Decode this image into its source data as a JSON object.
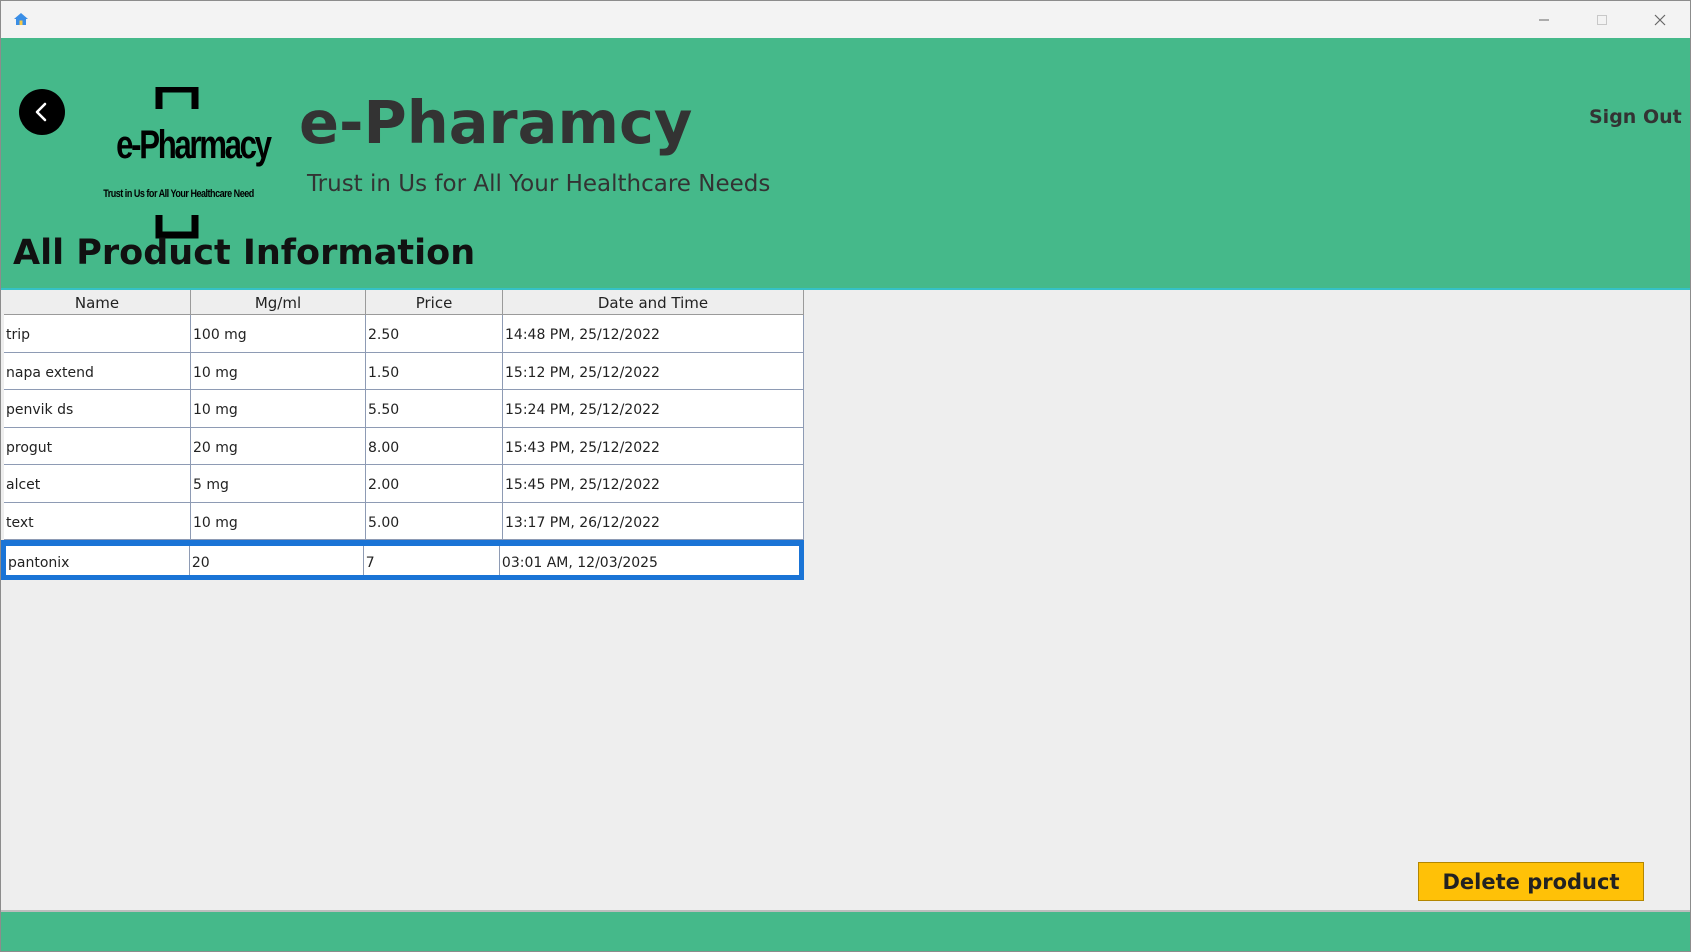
{
  "titlebar": {
    "icons": {
      "app": "home-icon",
      "minimize": "minimize-icon",
      "maximize": "maximize-icon",
      "close": "close-icon"
    }
  },
  "header": {
    "back_icon": "chevron-left-icon",
    "logo": {
      "main": "e-Pharmacy",
      "sub": "Trust in Us for All Your Healthcare Need"
    },
    "brand_title": "e-Pharamcy",
    "tagline": "Trust in Us for All Your Healthcare Needs",
    "signout_label": "Sign Out",
    "page_heading": "All Product Information"
  },
  "table": {
    "columns": [
      "Name",
      "Mg/ml",
      "Price",
      "Date and Time"
    ],
    "rows": [
      [
        "trip",
        "100 mg",
        "2.50",
        "14:48 PM, 25/12/2022"
      ],
      [
        "napa extend",
        "10 mg",
        "1.50",
        "15:12 PM, 25/12/2022"
      ],
      [
        "penvik ds",
        "10 mg",
        "5.50",
        "15:24 PM, 25/12/2022"
      ],
      [
        "progut",
        "20 mg",
        "8.00",
        "15:43 PM, 25/12/2022"
      ],
      [
        "alcet",
        "5 mg",
        "2.00",
        "15:45 PM, 25/12/2022"
      ],
      [
        "text",
        "10 mg",
        "5.00",
        "13:17 PM, 26/12/2022"
      ],
      [
        "pantonix",
        "20",
        "7",
        "03:01 AM, 12/03/2025"
      ]
    ],
    "selected_row": 6
  },
  "actions": {
    "delete_label": "Delete product"
  },
  "colors": {
    "header_bg": "#45b98a",
    "button_bg": "#ffc107",
    "selection": "#1a74d6",
    "text_dark": "#333333"
  }
}
